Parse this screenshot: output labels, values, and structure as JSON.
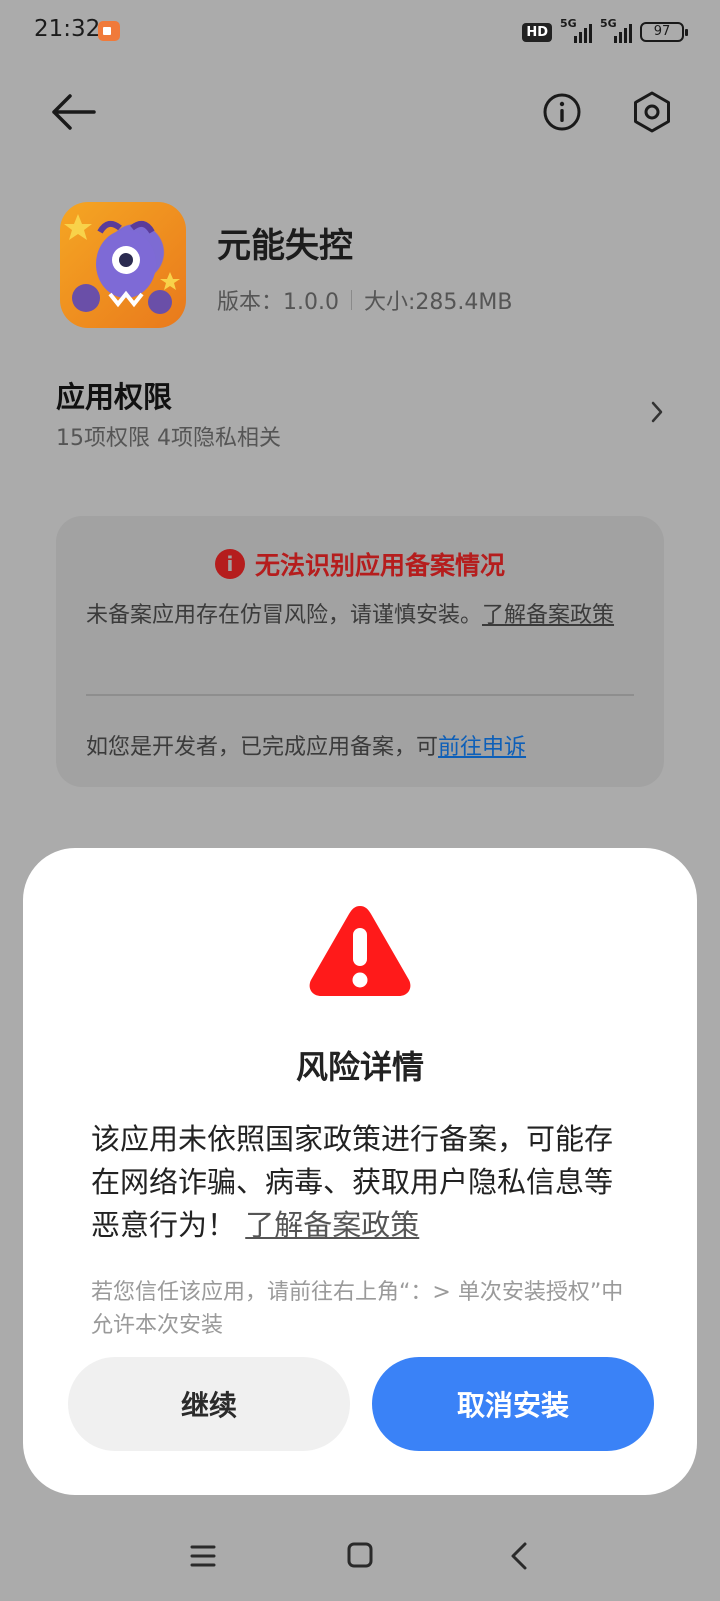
{
  "status_bar": {
    "time": "21:32",
    "hd_label": "HD",
    "network_1": "5G",
    "network_2": "5G",
    "battery": "97"
  },
  "header": {
    "back_icon": "arrow-left-icon",
    "info_icon": "info-circle-icon",
    "settings_icon": "settings-hexagon-icon"
  },
  "app": {
    "name": "元能失控",
    "version": "版本：1.0.0",
    "size": "大小:285.4MB"
  },
  "permissions": {
    "title": "应用权限",
    "summary": "15项权限 4项隐私相关"
  },
  "warning_card": {
    "title": "无法识别应用备案情况",
    "body": "未备案应用存在仿冒风险，请谨慎安装。",
    "policy_link": "了解备案政策",
    "developer_text": "如您是开发者，已完成应用备案，可",
    "appeal_link": "前往申诉",
    "accent_color": "#b51d1d"
  },
  "dialog": {
    "title": "风险详情",
    "body": "该应用未依照国家政策进行备案，可能存在网络诈骗、病毒、获取用户隐私信息等恶意行为！",
    "policy_link": "了解备案政策",
    "hint": "若您信任该应用，请前往右上角“：> 单次安装授权”中允许本次安装",
    "continue_label": "继续",
    "cancel_label": "取消安装",
    "warning_color": "#ff1a1a",
    "primary_color": "#3a82f7"
  },
  "nav_bar": {
    "menu_icon": "menu-icon",
    "home_icon": "home-icon",
    "back_icon": "back-chevron-icon"
  }
}
